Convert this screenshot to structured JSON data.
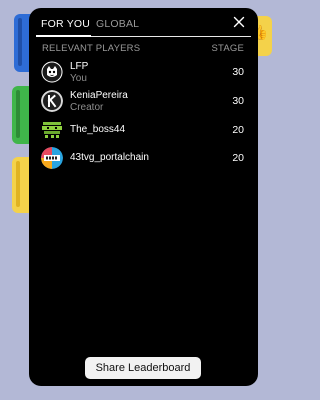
{
  "tabs": [
    {
      "label": "FOR YOU",
      "active": true
    },
    {
      "label": "GLOBAL",
      "active": false
    }
  ],
  "close_icon": "close-icon",
  "table_header": {
    "left": "RELEVANT PLAYERS",
    "right": "STAGE"
  },
  "players": [
    {
      "name": "LFP",
      "subtitle": "You",
      "stage": "30",
      "avatar": "lfp-avatar"
    },
    {
      "name": "KeniaPereira",
      "subtitle": "Creator",
      "stage": "30",
      "avatar": "k-avatar"
    },
    {
      "name": "The_boss44",
      "subtitle": "",
      "stage": "20",
      "avatar": "boss-avatar"
    },
    {
      "name": "43tvg_portalchain",
      "subtitle": "",
      "stage": "20",
      "avatar": "portal-avatar"
    }
  ],
  "share_button": "Share Leaderboard",
  "colors": {
    "panel_bg": "#000000",
    "page_bg": "#b3b8d6",
    "muted_text": "#9a9a9a",
    "button_bg": "#f2f2f2"
  }
}
